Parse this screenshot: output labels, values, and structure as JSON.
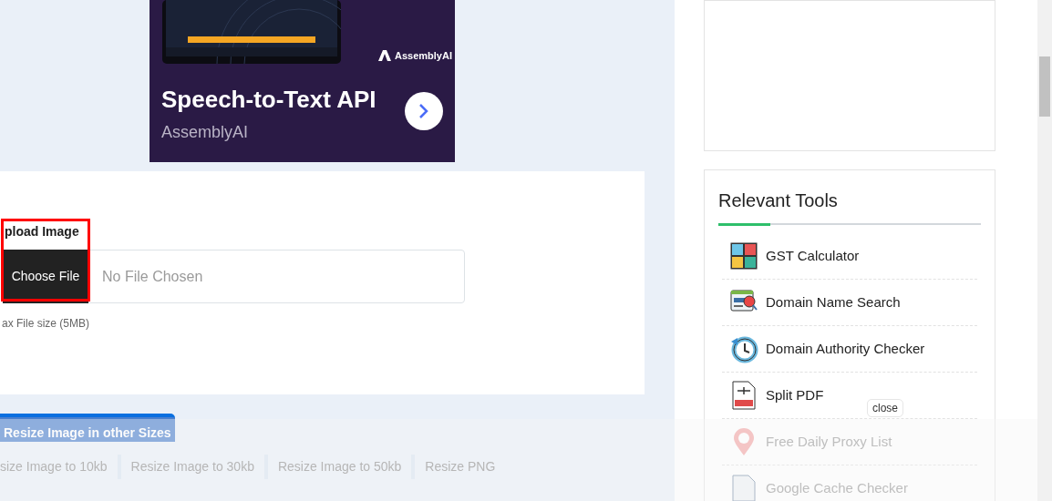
{
  "ad": {
    "logo": "AssemblyAI",
    "title": "Speech-to-Text API",
    "brand": "AssemblyAI"
  },
  "upload": {
    "label": "pload Image",
    "button": "Choose File",
    "placeholder": "No File Chosen",
    "note": "ax File size (5MB)"
  },
  "other_sizes": {
    "tab": "Resize Image in other Sizes",
    "links": [
      "size Image to 10kb",
      "Resize Image to 30kb",
      "Resize Image to 50kb",
      "Resize PNG"
    ]
  },
  "relevant_tools": {
    "title": "Relevant Tools",
    "items": [
      {
        "label": "GST Calculator"
      },
      {
        "label": "Domain Name Search"
      },
      {
        "label": "Domain Authority Checker"
      },
      {
        "label": "Split PDF"
      },
      {
        "label": "Free Daily Proxy List"
      },
      {
        "label": "Google Cache Checker"
      }
    ]
  },
  "overlay": {
    "close": "close"
  }
}
